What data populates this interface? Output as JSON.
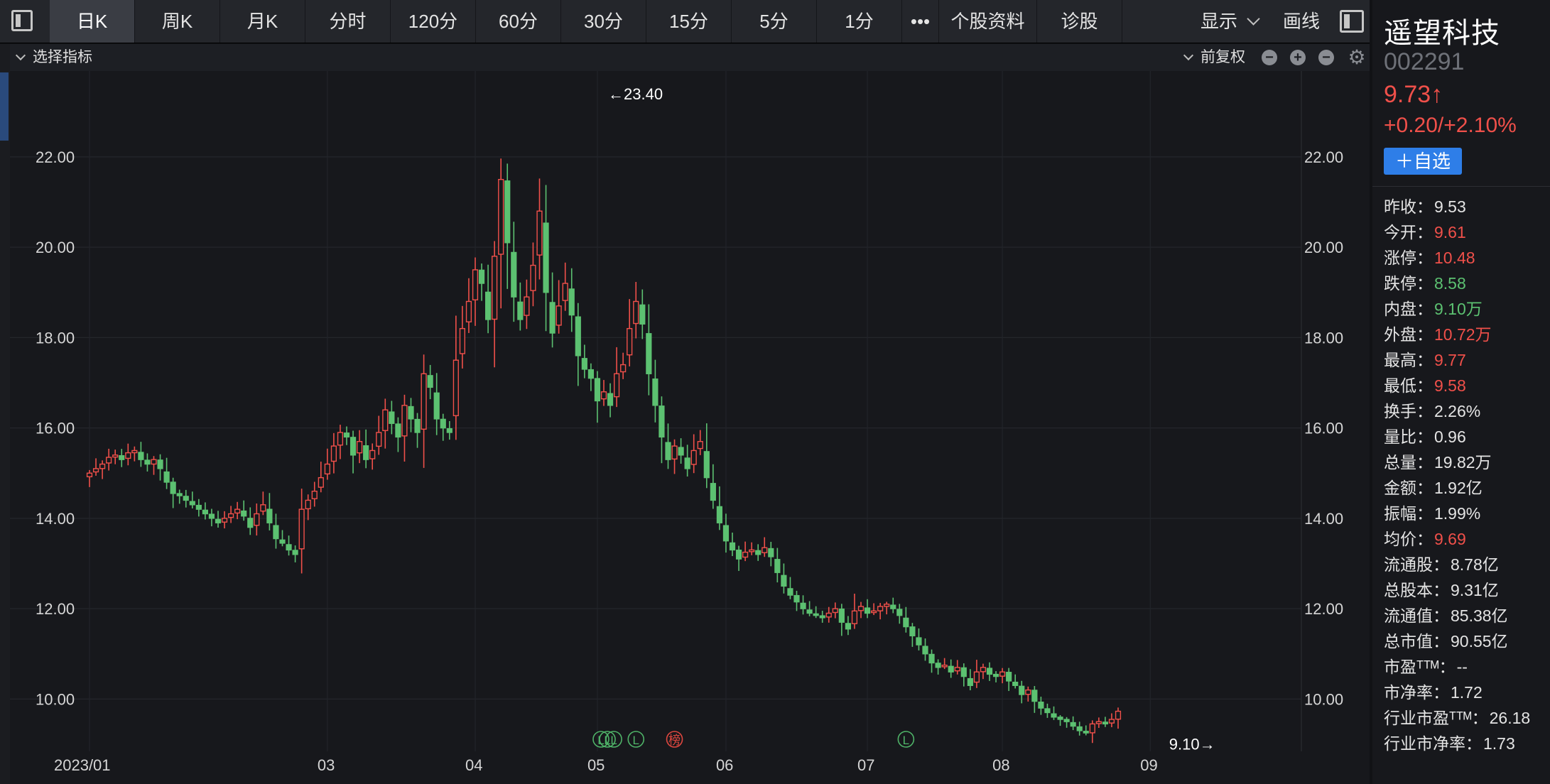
{
  "toolbar": {
    "tabs": [
      {
        "label": "日K",
        "active": true
      },
      {
        "label": "周K"
      },
      {
        "label": "月K"
      },
      {
        "label": "分时"
      },
      {
        "label": "120分"
      },
      {
        "label": "60分"
      },
      {
        "label": "30分"
      },
      {
        "label": "15分"
      },
      {
        "label": "5分"
      },
      {
        "label": "1分"
      },
      {
        "label": "•••"
      },
      {
        "label": "个股资料"
      },
      {
        "label": "诊股"
      }
    ],
    "display_label": "显示",
    "draw_label": "画线"
  },
  "indicator_bar": {
    "select_label": "选择指标",
    "adjust_label": "前复权",
    "icons": [
      "minus-circle-icon",
      "plus-circle-icon",
      "minus-circle-icon",
      "gear-icon"
    ]
  },
  "stock": {
    "name": "遥望科技",
    "code": "002291",
    "price": "9.73↑",
    "change": "+0.20/+2.10%",
    "watch_label": "＋自选",
    "stats": [
      {
        "label": "昨收：",
        "value": "9.53",
        "color": "neutral"
      },
      {
        "label": "今开：",
        "value": "9.61",
        "color": "red"
      },
      {
        "label": "涨停：",
        "value": "10.48",
        "color": "red"
      },
      {
        "label": "跌停：",
        "value": "8.58",
        "color": "green"
      },
      {
        "label": "内盘：",
        "value": "9.10万",
        "color": "green"
      },
      {
        "label": "外盘：",
        "value": "10.72万",
        "color": "red"
      },
      {
        "label": "最高：",
        "value": "9.77",
        "color": "red"
      },
      {
        "label": "最低：",
        "value": "9.58",
        "color": "red"
      },
      {
        "label": "换手：",
        "value": "2.26%",
        "color": "neutral"
      },
      {
        "label": "量比：",
        "value": "0.96",
        "color": "neutral"
      },
      {
        "label": "总量：",
        "value": "19.82万",
        "color": "neutral"
      },
      {
        "label": "金额：",
        "value": "1.92亿",
        "color": "neutral"
      },
      {
        "label": "振幅：",
        "value": "1.99%",
        "color": "neutral"
      },
      {
        "label": "均价：",
        "value": "9.69",
        "color": "red"
      },
      {
        "label": "流通股：",
        "value": "8.78亿",
        "color": "neutral"
      },
      {
        "label": "总股本：",
        "value": "9.31亿",
        "color": "neutral"
      },
      {
        "label": "流通值：",
        "value": "85.38亿",
        "color": "neutral"
      },
      {
        "label": "总市值：",
        "value": "90.55亿",
        "color": "neutral"
      },
      {
        "label": "市盈ᵀᵀᴹ：",
        "value": "--",
        "color": "neutral"
      },
      {
        "label": "市净率：",
        "value": "1.72",
        "color": "neutral"
      },
      {
        "label": "行业市盈ᵀᵀᴹ：",
        "value": "26.18",
        "color": "neutral"
      },
      {
        "label": "行业市净率：",
        "value": "1.73",
        "color": "neutral"
      }
    ]
  },
  "chart_data": {
    "type": "candlestick",
    "ylim": [
      9.0,
      23.9
    ],
    "y_ticks": [
      "10.00",
      "12.00",
      "14.00",
      "16.00",
      "18.00",
      "22.00",
      "20.00"
    ],
    "y_tick_values": [
      10,
      12,
      14,
      16,
      18,
      22,
      20
    ],
    "x_ticks": [
      {
        "label": "2023/01",
        "index": 0
      },
      {
        "label": "03",
        "index": 37
      },
      {
        "label": "04",
        "index": 60
      },
      {
        "label": "05",
        "index": 79
      },
      {
        "label": "06",
        "index": 99
      },
      {
        "label": "07",
        "index": 121
      },
      {
        "label": "08",
        "index": 142
      },
      {
        "label": "09",
        "index": 165
      }
    ],
    "max_marker": {
      "label": "←23.40",
      "index": 80,
      "value": 23.4
    },
    "min_marker": {
      "label": "9.10→",
      "index": 175,
      "value": 9.1
    },
    "event_markers": [
      {
        "label": "L",
        "index": 80
      },
      {
        "label": "L",
        "index": 81
      },
      {
        "label": "L",
        "index": 82
      },
      {
        "label": "L",
        "index": 85
      },
      {
        "label": "榜",
        "index": 91
      },
      {
        "label": "L",
        "index": 127
      }
    ],
    "up_color": "#f0504a",
    "down_color": "#5cc171",
    "closes": [
      15.0,
      15.1,
      15.2,
      15.35,
      15.4,
      15.3,
      15.45,
      15.5,
      15.3,
      15.2,
      15.3,
      15.1,
      14.8,
      14.55,
      14.5,
      14.4,
      14.3,
      14.2,
      14.1,
      14.0,
      13.9,
      14.0,
      14.1,
      14.2,
      14.05,
      13.8,
      14.1,
      14.3,
      13.9,
      13.55,
      13.45,
      13.3,
      13.2,
      14.2,
      14.4,
      14.6,
      14.9,
      15.2,
      15.6,
      15.9,
      15.8,
      15.4,
      15.7,
      15.3,
      15.5,
      15.9,
      16.4,
      16.1,
      15.8,
      16.5,
      16.2,
      15.9,
      17.2,
      16.9,
      16.2,
      16.0,
      15.9,
      17.5,
      18.2,
      18.8,
      19.5,
      19.2,
      18.4,
      19.8,
      21.5,
      20.1,
      18.9,
      18.4,
      18.9,
      19.6,
      20.8,
      19.0,
      18.1,
      18.7,
      19.2,
      18.5,
      17.6,
      17.3,
      17.1,
      16.6,
      16.8,
      16.5,
      17.2,
      17.4,
      18.2,
      18.8,
      18.3,
      17.2,
      16.5,
      15.8,
      15.3,
      15.6,
      15.4,
      15.1,
      15.5,
      15.7,
      14.9,
      14.4,
      13.9,
      13.5,
      13.3,
      13.1,
      13.25,
      13.3,
      13.2,
      13.35,
      13.15,
      12.8,
      12.5,
      12.3,
      12.15,
      12.0,
      11.9,
      11.85,
      11.8,
      11.9,
      12.0,
      11.7,
      11.55,
      11.95,
      12.05,
      11.9,
      11.95,
      12.05,
      12.1,
      12.0,
      11.85,
      11.6,
      11.4,
      11.2,
      11.0,
      10.8,
      10.7,
      10.75,
      10.6,
      10.7,
      10.5,
      10.3,
      10.6,
      10.7,
      10.55,
      10.5,
      10.6,
      10.4,
      10.3,
      10.1,
      10.2,
      9.95,
      9.8,
      9.7,
      9.6,
      9.55,
      9.5,
      9.4,
      9.3,
      9.25,
      9.45,
      9.5,
      9.45,
      9.55,
      9.73
    ]
  }
}
